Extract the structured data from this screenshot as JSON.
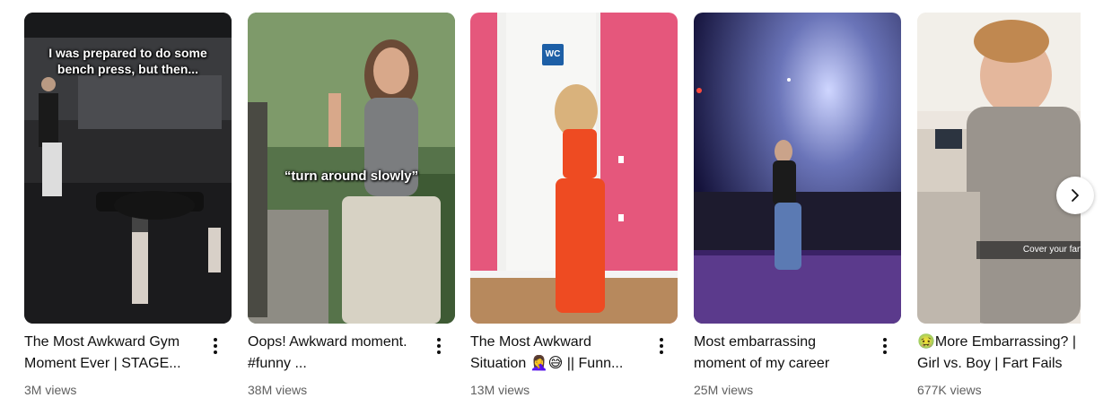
{
  "shelf": {
    "items": [
      {
        "title": "The Most Awkward Gym Moment Ever | STAGE...",
        "views": "3M views",
        "overlay": "I was prepared to do some bench press, but then..."
      },
      {
        "title": "Oops! Awkward moment.  #funny ...",
        "views": "38M views",
        "overlay": "“turn around slowly”"
      },
      {
        "title": "The Most Awkward Situation 🤦‍♀️😅 || Funn...",
        "views": "13M views",
        "overlay": "WC"
      },
      {
        "title": "Most embarrassing moment of my career",
        "views": "25M views",
        "overlay": ""
      },
      {
        "title": "🤢More Embarrassing? | Girl vs. Boy | Fart Fails",
        "views": "677K views",
        "overlay": "Cover your farts"
      }
    ],
    "icons": {
      "more": "more-vert-icon",
      "next": "chevron-right-icon"
    }
  }
}
